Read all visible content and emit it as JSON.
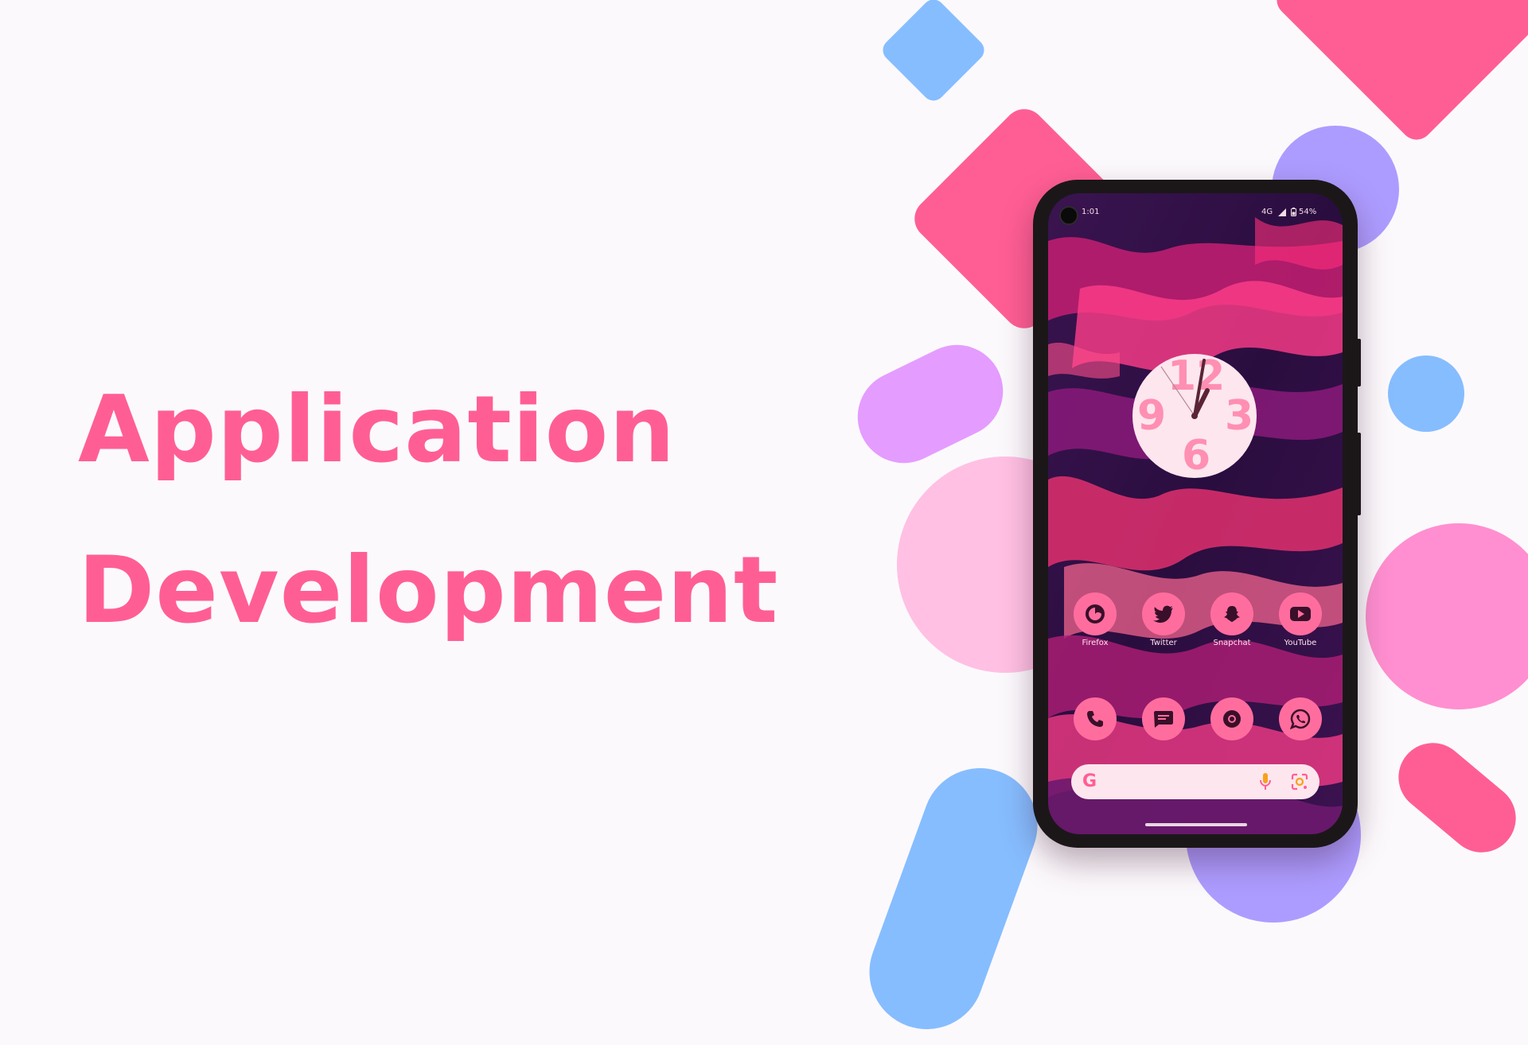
{
  "headline": {
    "line1": "Application",
    "line2": "Development"
  },
  "colors": {
    "accent": "#ff5e94",
    "background": "#fcf9fc",
    "blue": "#86bdff",
    "purple": "#ad9cff",
    "lilac": "#e59cff",
    "light_pink": "#ffc0e3",
    "pink": "#ff8fd0"
  },
  "phone": {
    "status_bar": {
      "time": "1:01",
      "network": "4G",
      "battery": "54%"
    },
    "clock": {
      "numbers": [
        "12",
        "3",
        "6",
        "9"
      ]
    },
    "apps_row1": [
      {
        "label": "Firefox",
        "icon": "firefox-icon"
      },
      {
        "label": "Twitter",
        "icon": "twitter-icon"
      },
      {
        "label": "Snapchat",
        "icon": "snapchat-icon"
      },
      {
        "label": "YouTube",
        "icon": "youtube-icon"
      }
    ],
    "apps_row2": [
      {
        "icon": "phone-icon"
      },
      {
        "icon": "messages-icon"
      },
      {
        "icon": "chrome-icon"
      },
      {
        "icon": "whatsapp-icon"
      }
    ],
    "search_bar": {
      "logo": "G",
      "icons": [
        "mic-icon",
        "lens-icon"
      ]
    }
  }
}
